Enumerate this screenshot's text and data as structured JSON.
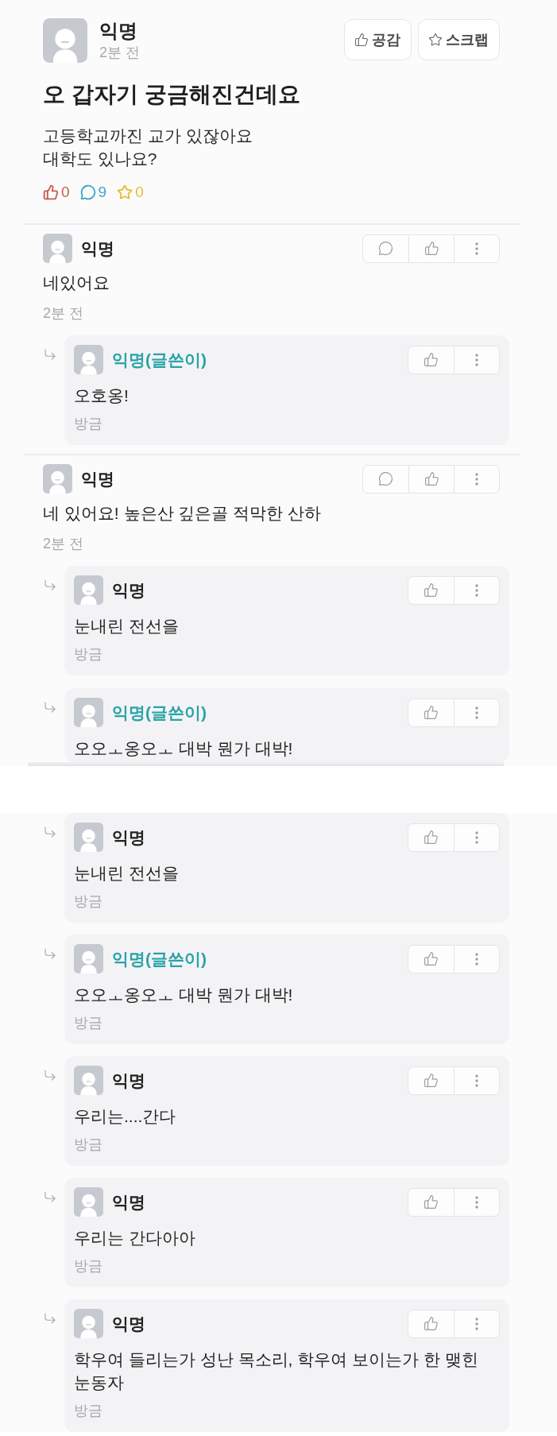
{
  "screenshots": [
    {
      "post": {
        "author": "익명",
        "time": "2분 전",
        "buttons": [
          {
            "kind": "like",
            "label": "공감"
          },
          {
            "kind": "scrap",
            "label": "스크랩"
          }
        ],
        "title": "오 갑자기 궁금해진건데요",
        "body_lines": [
          "고등학교까진 교가 있잖아요",
          "대학도 있나요?"
        ],
        "stats": [
          {
            "kind": "likes",
            "count": "0",
            "color": "#c95a4e"
          },
          {
            "kind": "comments",
            "count": "9",
            "color": "#3fa6c6"
          },
          {
            "kind": "scraps",
            "count": "0",
            "color": "#e5bd30"
          }
        ]
      },
      "threads": [
        {
          "comment": {
            "author": "익명",
            "writer": false,
            "text": "네있어요",
            "time": "2분 전",
            "actions": [
              {
                "kind": "reply"
              },
              {
                "kind": "like"
              },
              {
                "kind": "more"
              }
            ]
          },
          "replies": [
            {
              "author": "익명(글쓴이)",
              "writer": true,
              "text": "오호옹!",
              "time": "방금",
              "actions": [
                {
                  "kind": "like"
                },
                {
                  "kind": "more"
                }
              ]
            }
          ]
        },
        {
          "comment": {
            "author": "익명",
            "writer": false,
            "text": "네 있어요! 높은산 깊은골 적막한 산하",
            "time": "2분 전",
            "actions": [
              {
                "kind": "reply"
              },
              {
                "kind": "like"
              },
              {
                "kind": "more"
              }
            ]
          },
          "replies": [
            {
              "author": "익명",
              "writer": false,
              "text": "눈내린 전선을",
              "time": "방금",
              "actions": [
                {
                  "kind": "like"
                },
                {
                  "kind": "more"
                }
              ]
            },
            {
              "author": "익명(글쓴이)",
              "writer": true,
              "text": "오오ㅗ옹오ㅗ 대박 뭔가 대박!",
              "actions": [
                {
                  "kind": "like"
                },
                {
                  "kind": "more"
                }
              ]
            }
          ]
        }
      ]
    },
    {
      "threads": [
        {
          "replies": [
            {
              "author": "익명",
              "writer": false,
              "text": "눈내린 전선을",
              "time": "방금",
              "actions": [
                {
                  "kind": "like"
                },
                {
                  "kind": "more"
                }
              ]
            },
            {
              "author": "익명(글쓴이)",
              "writer": true,
              "text": "오오ㅗ옹오ㅗ 대박 뭔가 대박!",
              "time": "방금",
              "actions": [
                {
                  "kind": "like"
                },
                {
                  "kind": "more"
                }
              ]
            },
            {
              "author": "익명",
              "writer": false,
              "text": "우리는....간다",
              "time": "방금",
              "actions": [
                {
                  "kind": "like"
                },
                {
                  "kind": "more"
                }
              ]
            },
            {
              "author": "익명",
              "writer": false,
              "text": "우리는 간다아아",
              "time": "방금",
              "actions": [
                {
                  "kind": "like"
                },
                {
                  "kind": "more"
                }
              ]
            },
            {
              "author": "익명",
              "writer": false,
              "text": "학우여 들리는가 성난 목소리, 학우여 보이는가 한 맺힌 눈동자",
              "time": "방금",
              "actions": [
                {
                  "kind": "like"
                },
                {
                  "kind": "more"
                }
              ]
            }
          ]
        }
      ]
    }
  ]
}
